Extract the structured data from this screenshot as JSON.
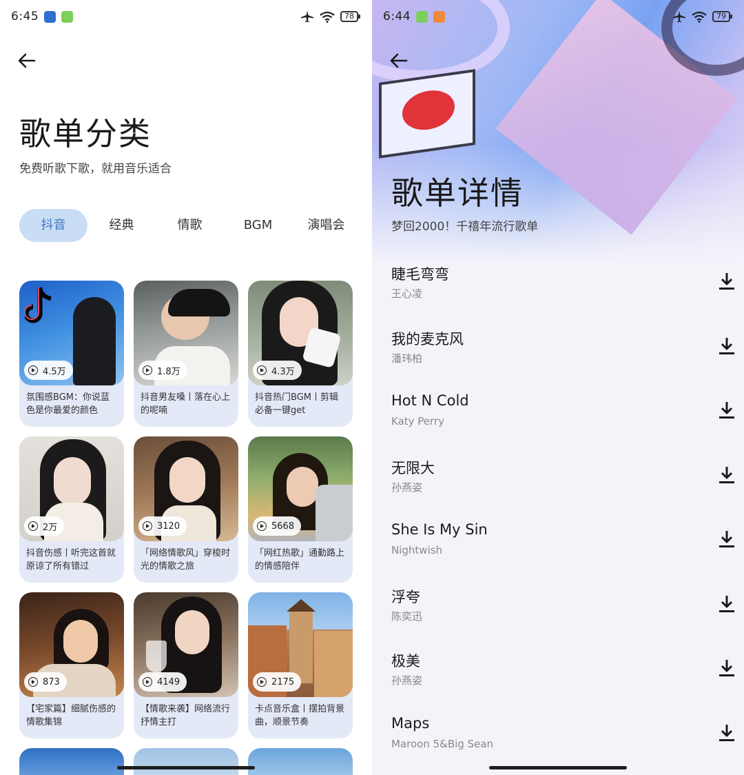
{
  "left": {
    "status": {
      "time": "6:45",
      "battery": "78"
    },
    "title": "歌单分类",
    "subtitle": "免费听歌下歌，就用音乐适合",
    "tabs": [
      {
        "label": "抖音",
        "active": true
      },
      {
        "label": "经典",
        "active": false
      },
      {
        "label": "情歌",
        "active": false
      },
      {
        "label": "BGM",
        "active": false
      },
      {
        "label": "演唱会",
        "active": false
      }
    ],
    "playlists": [
      {
        "count": "4.5万",
        "desc": "氛围感BGM：你说蓝色是你最爱的颜色"
      },
      {
        "count": "1.8万",
        "desc": "抖音男友嗓丨落在心上的呢喃"
      },
      {
        "count": "4.3万",
        "desc": "抖音热门BGM丨剪辑必备一键get"
      },
      {
        "count": "2万",
        "desc": "抖音伤感丨听完这首就原谅了所有错过"
      },
      {
        "count": "3120",
        "desc": "「网络情歌风」穿梭时光的情歌之旅"
      },
      {
        "count": "5668",
        "desc": "「网红热歌」通勤路上的情感陪伴"
      },
      {
        "count": "873",
        "desc": "【宅家篇】细腻伤感的情歌集锦"
      },
      {
        "count": "4149",
        "desc": "【情歌来袭】网络流行抒情主打"
      },
      {
        "count": "2175",
        "desc": "卡点音乐盒丨摆拍背景曲，顺景节奏"
      }
    ]
  },
  "right": {
    "status": {
      "time": "6:44",
      "battery": "79"
    },
    "title": "歌单详情",
    "subtitle": "梦回2000！千禧年流行歌单",
    "songs": [
      {
        "name": "睫毛弯弯",
        "artist": "王心凌"
      },
      {
        "name": "我的麦克风",
        "artist": "潘玮柏"
      },
      {
        "name": "Hot N Cold",
        "artist": "Katy Perry"
      },
      {
        "name": "无限大",
        "artist": "孙燕姿"
      },
      {
        "name": "She Is My Sin",
        "artist": "Nightwish"
      },
      {
        "name": "浮夸",
        "artist": "陈奕迅"
      },
      {
        "name": "极美",
        "artist": "孙燕姿"
      },
      {
        "name": "Maps",
        "artist": "Maroon 5&Big Sean"
      }
    ]
  },
  "colors": {
    "tab_active_bg": "#c9ddf5",
    "tab_active_text": "#3c76c4",
    "card_bg": "#e4e9f8"
  },
  "icons": {
    "back": "arrow-left-icon",
    "play": "play-circle-icon",
    "download": "download-icon",
    "airplane": "airplane-icon",
    "wifi": "wifi-icon",
    "battery": "battery-icon"
  }
}
